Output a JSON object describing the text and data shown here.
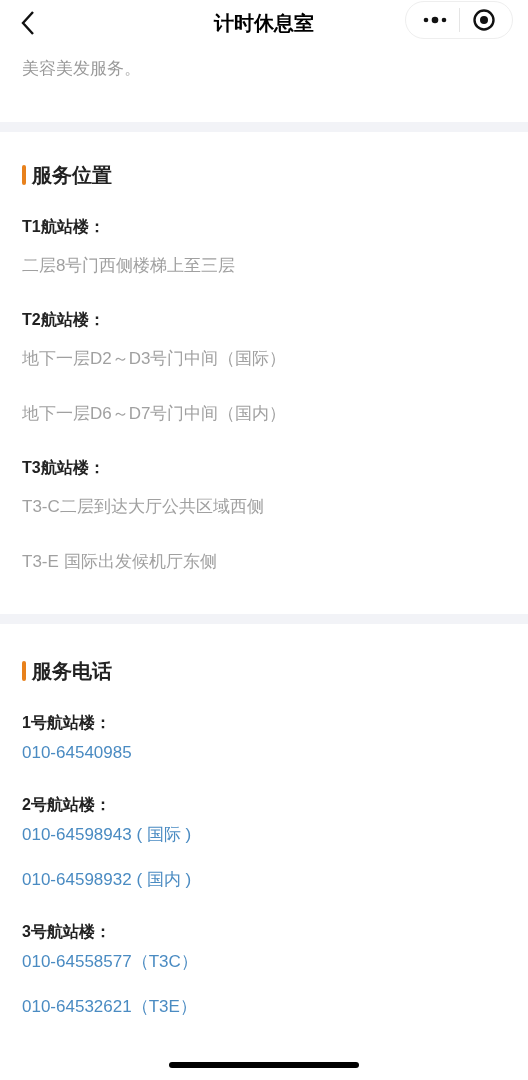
{
  "nav": {
    "title": "计时休息室"
  },
  "intro": "美容美发服务。",
  "sections": [
    {
      "kind": "location",
      "title": "服务位置",
      "groups": [
        {
          "label": "T1航站楼：",
          "items": [
            "二层8号门西侧楼梯上至三层"
          ]
        },
        {
          "label": "T2航站楼：",
          "items": [
            "地下一层D2～D3号门中间（国际）",
            "地下一层D6～D7号门中间（国内）"
          ]
        },
        {
          "label": "T3航站楼：",
          "items": [
            "T3-C二层到达大厅公共区域西侧",
            "T3-E 国际出发候机厅东侧"
          ]
        }
      ]
    },
    {
      "kind": "phone",
      "title": "服务电话",
      "groups": [
        {
          "label": "1号航站楼：",
          "items": [
            "010-64540985"
          ]
        },
        {
          "label": "2号航站楼：",
          "items": [
            "010-64598943 ( 国际 )",
            "010-64598932 ( 国内 )"
          ]
        },
        {
          "label": "3号航站楼：",
          "items": [
            "010-64558577（T3C）",
            "010-64532621（T3E）"
          ]
        }
      ]
    }
  ]
}
